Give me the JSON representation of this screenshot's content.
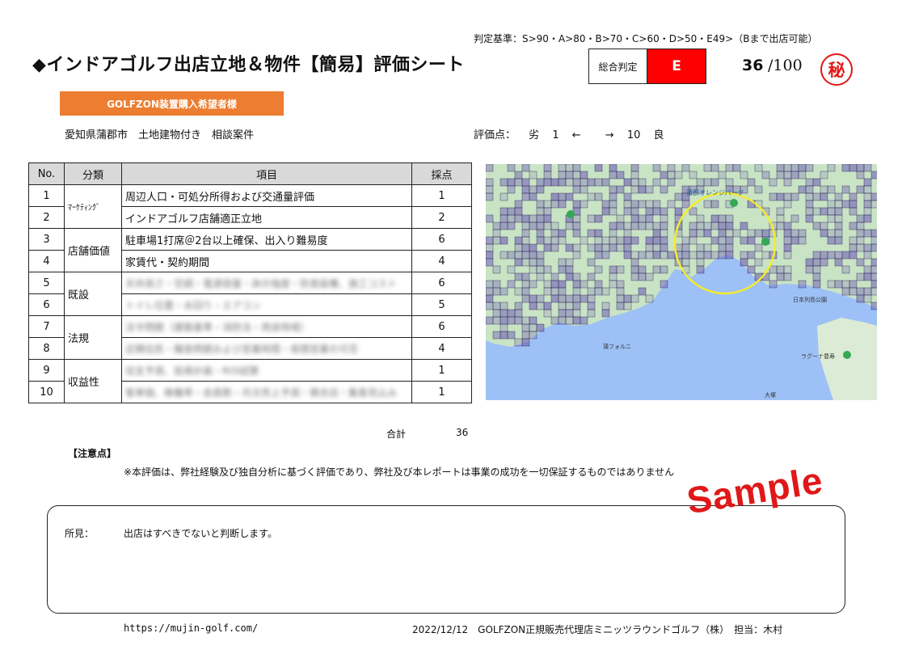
{
  "header": {
    "criteria": "判定基準：S>90・A>80・B>70・C>60・D>50・E49>（Bまで出店可能）",
    "title": "◆インドアゴルフ出店立地＆物件【簡易】評価シート",
    "judge_label": "総合判定",
    "judge_grade": "E",
    "score": "36",
    "score_max": "/100",
    "seal": "秘"
  },
  "banner": "GOLFZON装置購入希望者様",
  "subject": "愛知県蒲郡市　土地建物付き　相談案件",
  "scale": {
    "label": "評価点：",
    "low_word": "劣",
    "low_num": "1",
    "left_arrow": "←",
    "right_arrow": "→",
    "high_num": "10",
    "high_word": "良"
  },
  "table": {
    "headers": [
      "No.",
      "分類",
      "項目",
      "採点"
    ],
    "categories": [
      "ﾏｰｹﾃｨﾝｸﾞ",
      "店舗価値",
      "既設",
      "法規",
      "収益性"
    ],
    "rows": [
      {
        "no": "1",
        "item": "周辺人口・可処分所得および交通量評価",
        "score": "1"
      },
      {
        "no": "2",
        "item": "インドアゴルフ店舗適正立地",
        "score": "2"
      },
      {
        "no": "3",
        "item": "駐車場1打席＠2台以上確保、出入り難易度",
        "score": "6"
      },
      {
        "no": "4",
        "item": "家賃代・契約期間",
        "score": "4"
      },
      {
        "no": "5",
        "item": "天井高さ・空調・電源容量・床の強度・防音設備、施工コスト",
        "score": "6"
      },
      {
        "no": "6",
        "item": "トイレ位置・水回り・エアコン",
        "score": "5"
      },
      {
        "no": "7",
        "item": "法令問題（建築基準・消防法・用途地域）",
        "score": "6"
      },
      {
        "no": "8",
        "item": "近隣住民・騒音問題および営業時間・夜間営業の可否",
        "score": "4"
      },
      {
        "no": "9",
        "item": "収支予測、投資計画・ROI試算",
        "score": "1"
      },
      {
        "no": "10",
        "item": "客単価、稼働率・会員数・月次売上予測・競合店・集客見込み",
        "score": "1"
      }
    ]
  },
  "map": {
    "labels": [
      "蒲郡オレンジパーク",
      "日本列島公園",
      "蒲フォルニ",
      "ラグーナ豊寿",
      "大塚"
    ],
    "colors": {
      "sea": "#9dc1f6",
      "land": "#c9e4c5",
      "land_alt": "#dbebd5",
      "grid": "#6c5ab4",
      "circle": "#f5ec2a"
    }
  },
  "total": {
    "label": "合計",
    "value": "36"
  },
  "caution": {
    "title": "【注意点】",
    "text": "※本評価は、弊社経験及び独自分析に基づく評価であり、弊社及び本レポートは事業の成功を一切保証するものではありません"
  },
  "opinion": {
    "label": "所見：",
    "text": "出店はすべきでないと判断します。"
  },
  "watermark": "Sample",
  "footer": {
    "url": "https://mujin-golf.com/",
    "info": "2022/12/12　GOLFZON正規販売代理店ミニッツラウンドゴルフ（株）　担当：木村"
  }
}
